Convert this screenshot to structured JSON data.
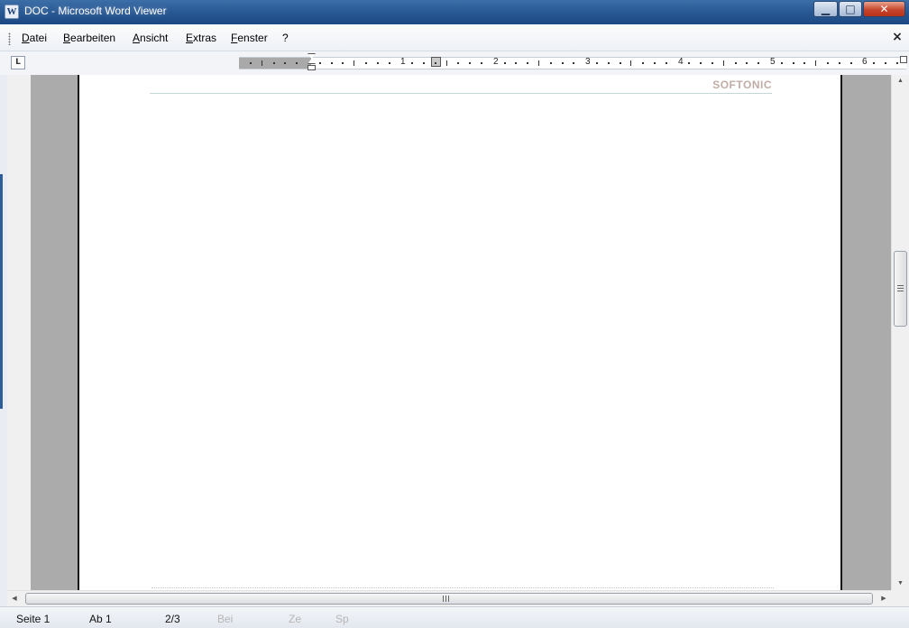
{
  "window": {
    "title": "DOC - Microsoft Word Viewer",
    "app_icon_letter": "W",
    "controls": {
      "minimize": "▁",
      "maximize": "□",
      "close": "✕"
    }
  },
  "menu": {
    "items": [
      {
        "label": "Datei"
      },
      {
        "label": "Bearbeiten"
      },
      {
        "label": "Ansicht"
      },
      {
        "label": "Extras"
      },
      {
        "label": "Fenster"
      },
      {
        "label": "?"
      }
    ],
    "close_glyph": "×"
  },
  "ruler": {
    "tab_selector": "L",
    "numbers": [
      "1",
      "2",
      "3",
      "4",
      "5",
      "6"
    ]
  },
  "document": {
    "header_brand": "SOFTONIC"
  },
  "scrollbars": {
    "up": "▲",
    "down": "▼",
    "left": "◀",
    "right": "▶"
  },
  "status": {
    "page": "Seite 1",
    "section": "Ab 1",
    "page_count": "2/3",
    "at": "Bei",
    "line": "Ze",
    "col": "Sp"
  }
}
